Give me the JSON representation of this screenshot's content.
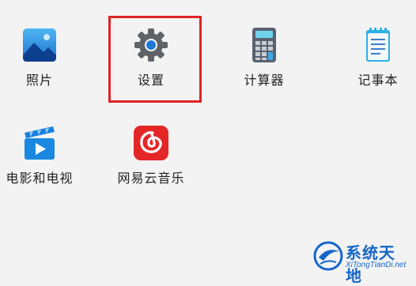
{
  "apps": [
    {
      "label": "照片",
      "icon": "photos-icon"
    },
    {
      "label": "设置",
      "icon": "settings-gear-icon",
      "selected": true
    },
    {
      "label": "计算器",
      "icon": "calculator-icon"
    },
    {
      "label": "记事本",
      "icon": "notepad-icon"
    },
    {
      "label": "电影和电视",
      "icon": "movies-tv-icon"
    },
    {
      "label": "网易云音乐",
      "icon": "netease-music-icon"
    }
  ],
  "watermark": {
    "title": "系统天地",
    "subtitle": "XiTongTianDi.net"
  },
  "colors": {
    "selection_border": "#e02424",
    "watermark": "#1466c8"
  }
}
